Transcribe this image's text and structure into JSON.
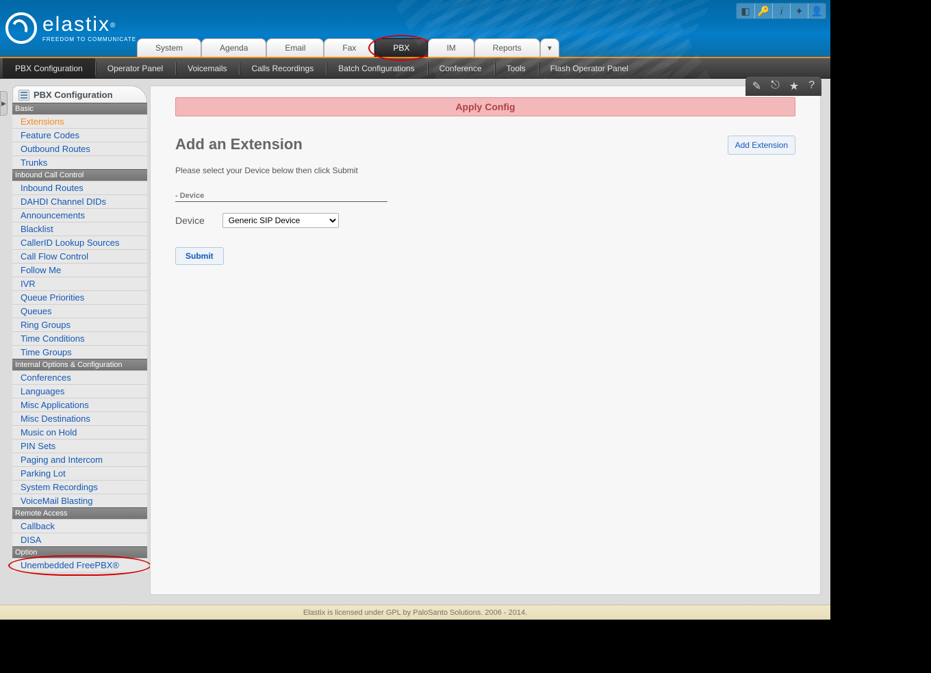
{
  "logo": {
    "text": "elastix",
    "sub": "FREEDOM TO COMMUNICATE"
  },
  "top_tabs": [
    "System",
    "Agenda",
    "Email",
    "Fax",
    "PBX",
    "IM",
    "Reports"
  ],
  "top_tab_active": "PBX",
  "subnav": [
    "PBX Configuration",
    "Operator Panel",
    "Voicemails",
    "Calls Recordings",
    "Batch Configurations",
    "Conference",
    "Tools",
    "Flash Operator Panel"
  ],
  "subnav_active": "PBX Configuration",
  "side_title": "PBX Configuration",
  "side": [
    {
      "head": "Basic",
      "items": [
        "Extensions",
        "Feature Codes",
        "Outbound Routes",
        "Trunks"
      ],
      "active": "Extensions"
    },
    {
      "head": "Inbound Call Control",
      "items": [
        "Inbound Routes",
        "DAHDI Channel DIDs",
        "Announcements",
        "Blacklist",
        "CallerID Lookup Sources",
        "Call Flow Control",
        "Follow Me",
        "IVR",
        "Queue Priorities",
        "Queues",
        "Ring Groups",
        "Time Conditions",
        "Time Groups"
      ]
    },
    {
      "head": "Internal Options & Configuration",
      "items": [
        "Conferences",
        "Languages",
        "Misc Applications",
        "Misc Destinations",
        "Music on Hold",
        "PIN Sets",
        "Paging and Intercom",
        "Parking Lot",
        "System Recordings",
        "VoiceMail Blasting"
      ]
    },
    {
      "head": "Remote Access",
      "items": [
        "Callback",
        "DISA"
      ]
    },
    {
      "head": "Option",
      "items": [
        "Unembedded FreePBX®"
      ],
      "circled": true
    }
  ],
  "apply_bar": "Apply Config",
  "add_ext_btn": "Add Extension",
  "page_heading": "Add an Extension",
  "instruction": "Please select your Device below then click Submit",
  "section_label": "- Device",
  "field_label": "Device",
  "device_select": "Generic SIP Device",
  "submit_label": "Submit",
  "footer": "Elastix is licensed under GPL by PaloSanto Solutions. 2006 - 2014."
}
